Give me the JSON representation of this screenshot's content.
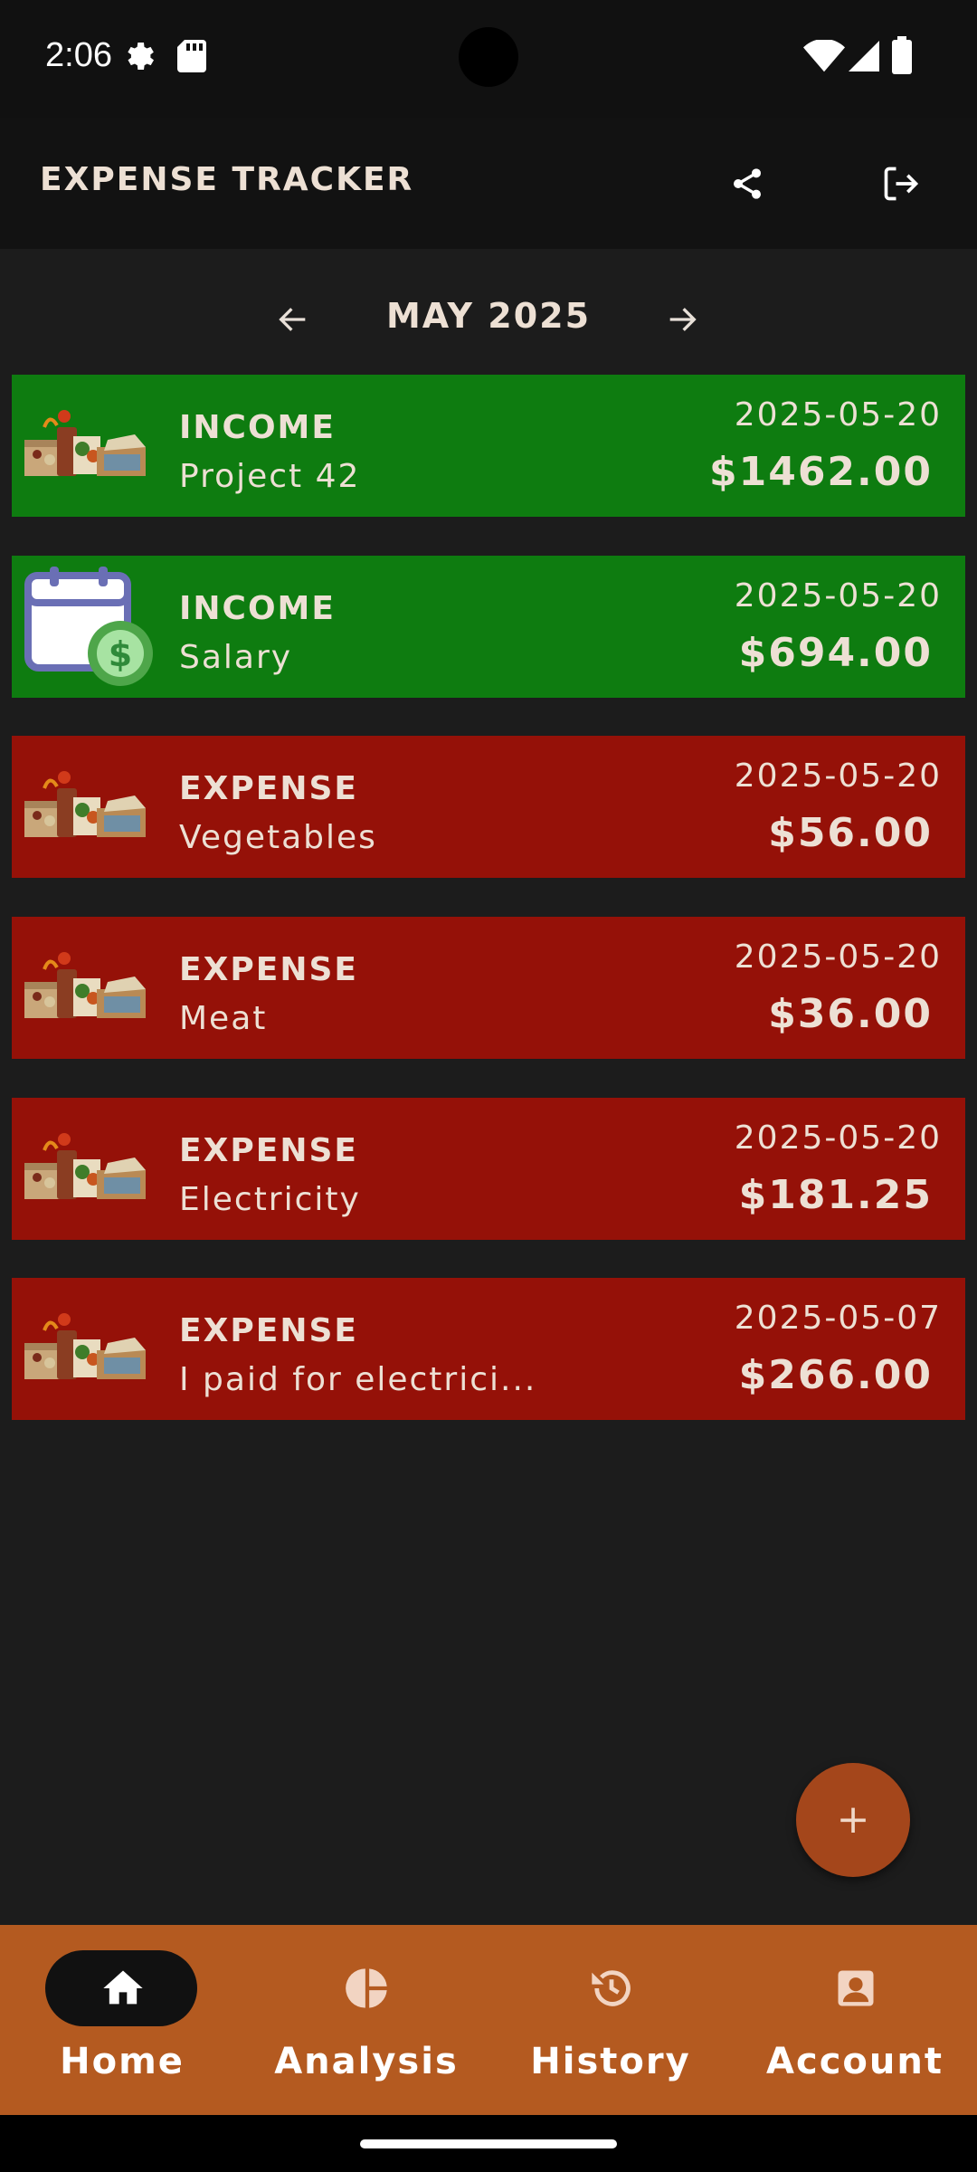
{
  "status_bar": {
    "time": "2:06"
  },
  "app_bar": {
    "title": "EXPENSE TRACKER",
    "actions": [
      "share-icon",
      "logout-icon"
    ]
  },
  "month_nav": {
    "label": "MAY 2025"
  },
  "transactions": [
    {
      "type": "INCOME",
      "description": "Project 42",
      "date": "2025-05-20",
      "amount": "$1462.00",
      "icon": "groceries-icon"
    },
    {
      "type": "INCOME",
      "description": "Salary",
      "date": "2025-05-20",
      "amount": "$694.00",
      "icon": "calendar-money-icon"
    },
    {
      "type": "EXPENSE",
      "description": "Vegetables",
      "date": "2025-05-20",
      "amount": "$56.00",
      "icon": "groceries-icon"
    },
    {
      "type": "EXPENSE",
      "description": "Meat",
      "date": "2025-05-20",
      "amount": "$36.00",
      "icon": "groceries-icon"
    },
    {
      "type": "EXPENSE",
      "description": "Electricity",
      "date": "2025-05-20",
      "amount": "$181.25",
      "icon": "groceries-icon"
    },
    {
      "type": "EXPENSE",
      "description": "I paid for electrici...",
      "date": "2025-05-07",
      "amount": "$266.00",
      "icon": "groceries-icon"
    }
  ],
  "fab": {
    "label": "+"
  },
  "bottom_nav": {
    "items": [
      {
        "label": "Home",
        "icon": "home-icon",
        "active": true
      },
      {
        "label": "Analysis",
        "icon": "pie-chart-icon",
        "active": false
      },
      {
        "label": "History",
        "icon": "history-icon",
        "active": false
      },
      {
        "label": "Account",
        "icon": "account-icon",
        "active": false
      }
    ]
  },
  "colors": {
    "income": "#0e7c10",
    "expense": "#951108",
    "accent": "#b45a20",
    "fab": "#a4461b",
    "background": "#1c1c1c"
  }
}
